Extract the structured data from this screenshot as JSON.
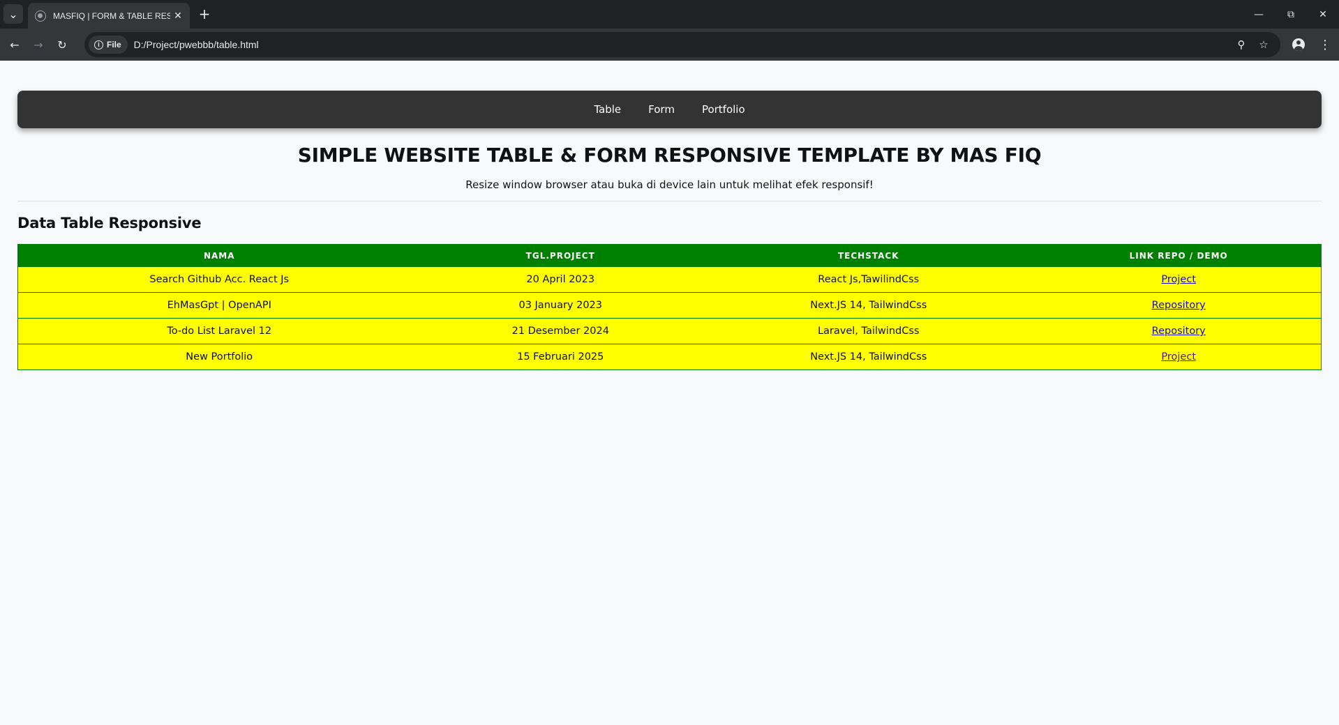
{
  "browser": {
    "tab_title": "MASFIQ | FORM & TABLE RESPONSIVE",
    "chip_label": "File",
    "url": "D:/Project/pwebbb/table.html"
  },
  "nav": {
    "items": [
      "Table",
      "Form",
      "Portfolio"
    ]
  },
  "header": {
    "title": "SIMPLE WEBSITE TABLE & FORM RESPONSIVE TEMPLATE BY MAS FIQ",
    "subtitle": "Resize window browser atau buka di device lain untuk melihat efek responsif!"
  },
  "section": {
    "title": "Data Table Responsive"
  },
  "table": {
    "headers": [
      "Nama",
      "Tgl.Project",
      "Techstack",
      "Link Repo / Demo"
    ],
    "rows": [
      [
        "Search Github Acc. React Js",
        "20 April 2023",
        "React Js,TawilindCss",
        "Project"
      ],
      [
        "EhMasGpt | OpenAPI",
        "03 January 2023",
        "Next.JS 14, TailwindCss",
        "Repository"
      ],
      [
        "To-do List Laravel 12",
        "21 Desember 2024",
        "Laravel, TailwindCss",
        "Repository"
      ],
      [
        "New Portfolio",
        "15 Februari 2025",
        "Next.JS 14, TailwindCss",
        "Project"
      ]
    ]
  },
  "colors": {
    "navbar": "#333333",
    "table_header": "#008000",
    "table_row": "#ffff00"
  }
}
